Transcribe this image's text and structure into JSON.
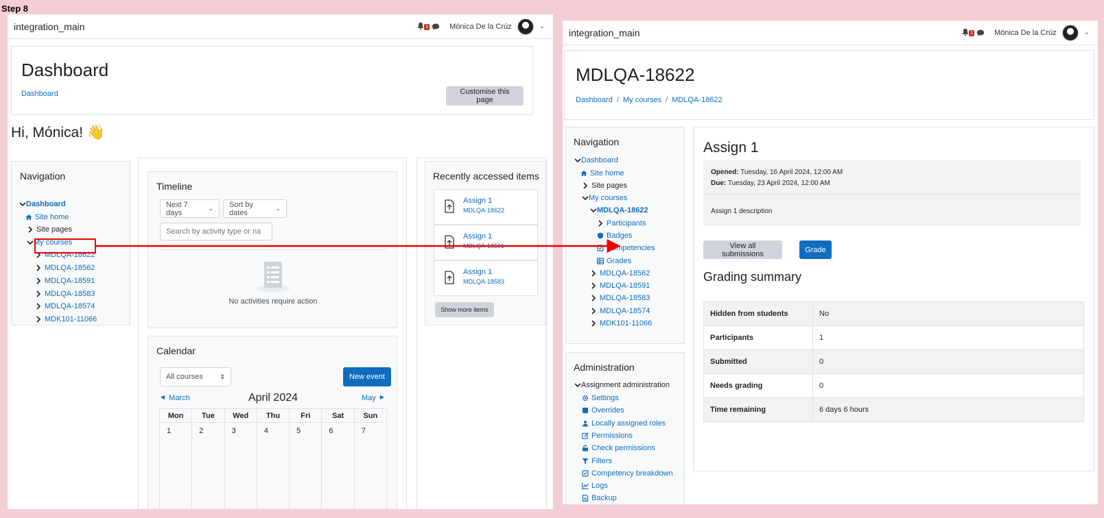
{
  "step_label": "Step 8",
  "left": {
    "topbar": {
      "brand": "integration_main",
      "notif_count": "1",
      "user_name": "Mónica De la Crúz"
    },
    "header": {
      "title": "Dashboard",
      "breadcrumb": "Dashboard",
      "customise_button": "Customise this page"
    },
    "greeting": "Hi, Mónica! 👋",
    "navigation": {
      "title": "Navigation",
      "dashboard": "Dashboard",
      "site_home": "Site home",
      "site_pages": "Site pages",
      "my_courses": "My courses",
      "courses": [
        "MDLQA-18622",
        "MDLQA-18562",
        "MDLQA-18591",
        "MDLQA-18583",
        "MDLQA-18574",
        "MDK101-11066"
      ]
    },
    "timeline": {
      "title": "Timeline",
      "range_select": "Next 7 days",
      "sort_select": "Sort by dates",
      "search_placeholder": "Search by activity type or na",
      "empty_message": "No activities require action"
    },
    "calendar": {
      "title": "Calendar",
      "course_select": "All courses",
      "new_event": "New event",
      "prev_month": "March",
      "month": "April 2024",
      "next_month": "May",
      "days": [
        "Mon",
        "Tue",
        "Wed",
        "Thu",
        "Fri",
        "Sat",
        "Sun"
      ],
      "first_week": [
        "1",
        "2",
        "3",
        "4",
        "5",
        "6",
        "7"
      ]
    },
    "recent": {
      "title": "Recently accessed items",
      "items": [
        {
          "name": "Assign 1",
          "course": "MDLQA-18622"
        },
        {
          "name": "Assign 1",
          "course": "MDLQA-18591"
        },
        {
          "name": "Assign 1",
          "course": "MDLQA-18583"
        }
      ],
      "show_more": "Show more items"
    }
  },
  "right": {
    "topbar": {
      "brand": "integration_main",
      "notif_count": "1",
      "user_name": "Mónica De la Crúz"
    },
    "header": {
      "title": "MDLQA-18622",
      "crumbs": [
        "Dashboard",
        "My courses",
        "MDLQA-18622"
      ],
      "sep": "/"
    },
    "navigation": {
      "title": "Navigation",
      "dashboard": "Dashboard",
      "site_home": "Site home",
      "site_pages": "Site pages",
      "my_courses": "My courses",
      "current_course": "MDLQA-18622",
      "participants": "Participants",
      "badges": "Badges",
      "competencies": "Competencies",
      "grades": "Grades",
      "other_courses": [
        "MDLQA-18562",
        "MDLQA-18591",
        "MDLQA-18583",
        "MDLQA-18574",
        "MDK101-11066"
      ]
    },
    "administration": {
      "title": "Administration",
      "section": "Assignment administration",
      "items": [
        "Settings",
        "Overrides",
        "Locally assigned roles",
        "Permissions",
        "Check permissions",
        "Filters",
        "Competency breakdown",
        "Logs",
        "Backup"
      ]
    },
    "assign": {
      "title": "Assign 1",
      "opened_label": "Opened:",
      "opened_value": "Tuesday, 16 April 2024, 12:00 AM",
      "due_label": "Due:",
      "due_value": "Tuesday, 23 April 2024, 12:00 AM",
      "description": "Assign 1 description",
      "view_all": "View all submissions",
      "grade": "Grade",
      "summary_title": "Grading summary",
      "summary": [
        {
          "k": "Hidden from students",
          "v": "No"
        },
        {
          "k": "Participants",
          "v": "1"
        },
        {
          "k": "Submitted",
          "v": "0"
        },
        {
          "k": "Needs grading",
          "v": "0"
        },
        {
          "k": "Time remaining",
          "v": "6 days 6 hours"
        }
      ]
    }
  }
}
